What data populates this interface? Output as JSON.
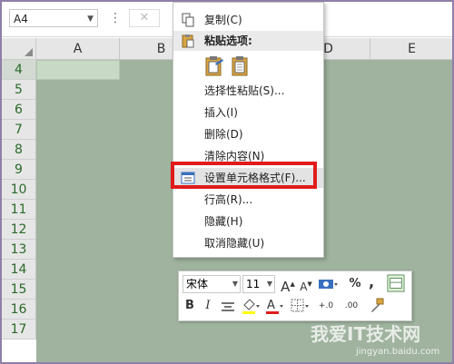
{
  "formula_bar": {
    "name_box": "A4",
    "dots": "⋮",
    "cancel": "✕"
  },
  "columns": [
    "A",
    "B",
    "C",
    "D",
    "E"
  ],
  "rows": [
    "4",
    "5",
    "6",
    "7",
    "8",
    "9",
    "10",
    "11",
    "12",
    "13",
    "14",
    "15",
    "16",
    "17"
  ],
  "context_menu": {
    "copy": "复制(C)",
    "paste_options_header": "粘贴选项:",
    "paste_special": "选择性粘贴(S)...",
    "insert": "插入(I)",
    "delete": "删除(D)",
    "clear_contents": "清除内容(N)",
    "format_cells": "设置单元格格式(F)...",
    "row_height": "行高(R)...",
    "hide": "隐藏(H)",
    "unhide": "取消隐藏(U)"
  },
  "mini_toolbar": {
    "font_name": "宋体",
    "font_size": "11",
    "grow_font": "A",
    "shrink_font": "A",
    "percent": "%",
    "comma": ",",
    "bold": "B",
    "italic": "I",
    "inc_decimal": "+.0",
    "dec_decimal": ".00"
  },
  "colors": {
    "highlight_box": "#e01b1b",
    "cell_fill": "#9fb39f",
    "font_color_bar": "#e01b1b",
    "fill_color_bar": "#ffff00"
  },
  "watermark": {
    "text": "我爱IT技术网",
    "url": "jingyan.baidu.com"
  }
}
